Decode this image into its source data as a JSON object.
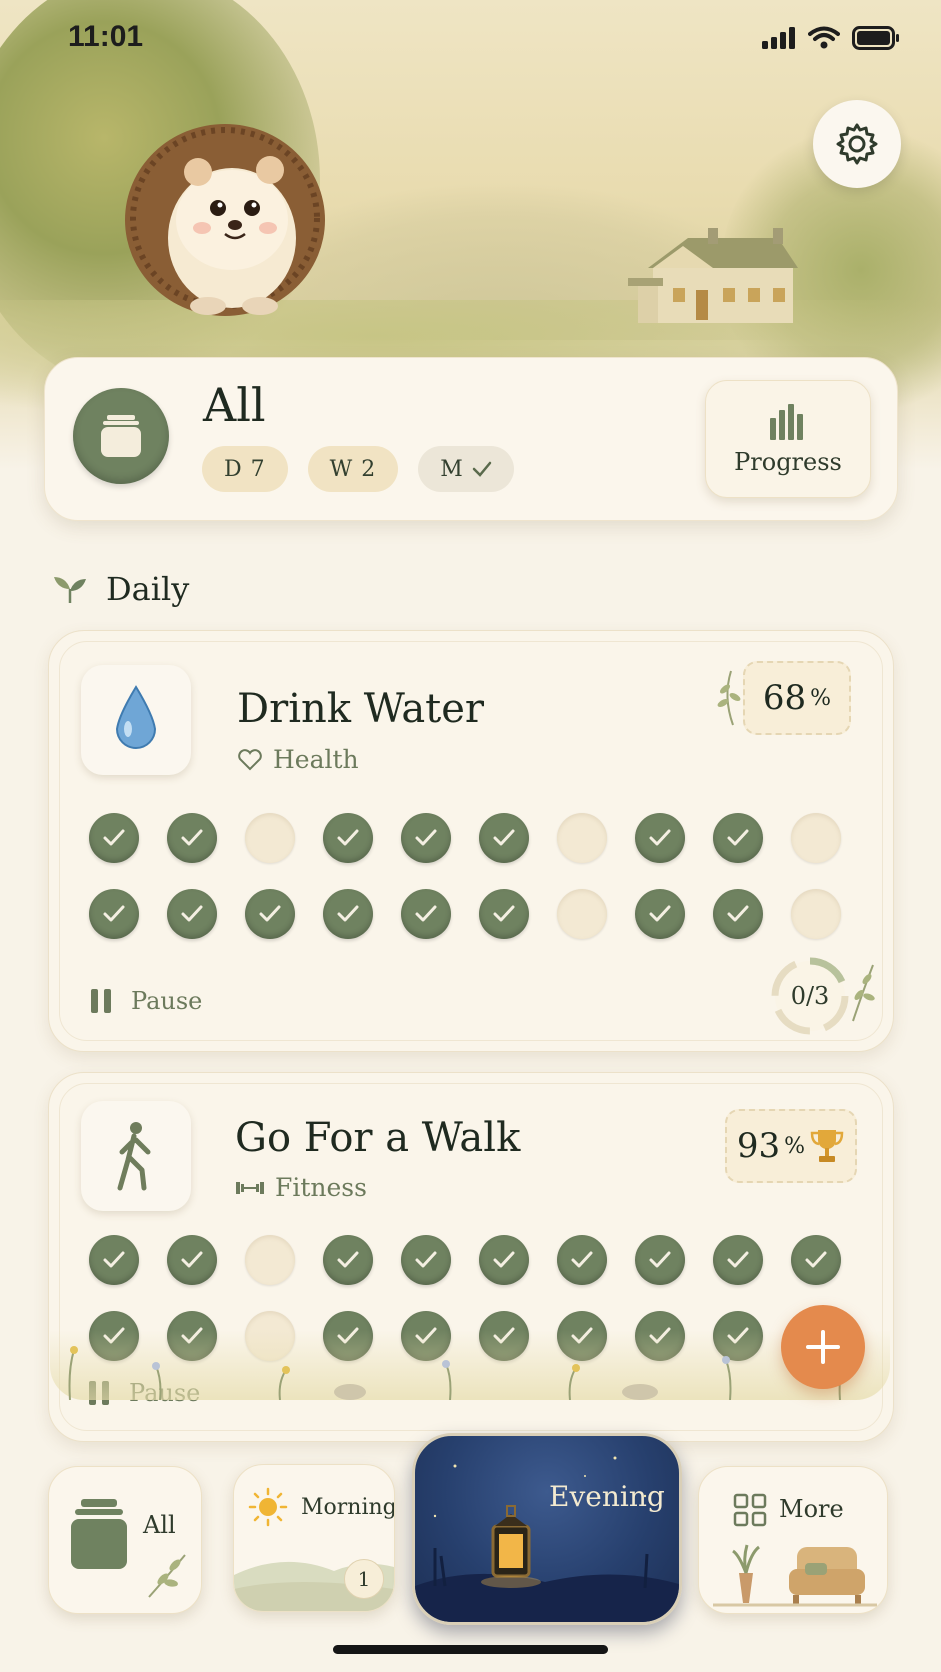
{
  "status_bar": {
    "time": "11:01"
  },
  "header": {
    "settings_icon": "gear-icon",
    "summary": {
      "title": "All",
      "pills": [
        {
          "label": "D 7"
        },
        {
          "label": "W 2"
        },
        {
          "label": "M",
          "icon": "check-icon"
        }
      ],
      "progress_label": "Progress"
    }
  },
  "section": {
    "title": "Daily",
    "icon": "sprout-icon"
  },
  "habits": [
    {
      "name": "Drink Water",
      "category": "Health",
      "category_icon": "heart-icon",
      "percent": "68",
      "percent_unit": "%",
      "checks_row1": [
        true,
        true,
        false,
        true,
        true,
        true,
        false,
        true,
        true,
        false
      ],
      "checks_row2": [
        true,
        true,
        true,
        true,
        true,
        true,
        false,
        true,
        true,
        false
      ],
      "pause_label": "Pause",
      "today_count": "0/3"
    },
    {
      "name": "Go For a Walk",
      "category": "Fitness",
      "category_icon": "dumbbell-icon",
      "percent": "93",
      "percent_unit": "%",
      "checks_row1": [
        true,
        true,
        false,
        true,
        true,
        true,
        true,
        true,
        true,
        true
      ],
      "checks_row2": [
        true,
        true,
        false,
        true,
        true,
        true,
        true,
        true,
        true
      ],
      "pause_label": "Pause"
    }
  ],
  "tabs": [
    {
      "label": "All"
    },
    {
      "label": "Morning",
      "badge": "1"
    },
    {
      "label": "Evening"
    },
    {
      "label": "More"
    }
  ],
  "colors": {
    "accent": "#6f8260",
    "fab": "#e48a4d",
    "background": "#f8f3e8"
  }
}
